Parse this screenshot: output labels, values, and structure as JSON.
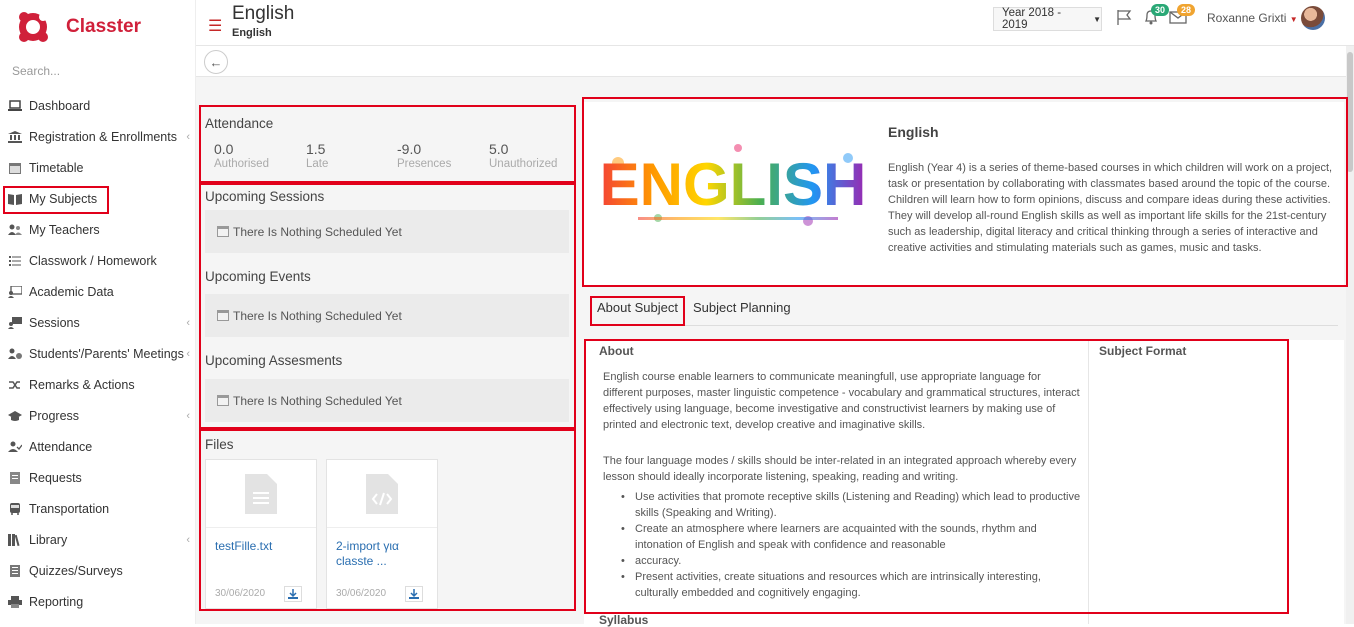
{
  "app": {
    "name": "Classter"
  },
  "search": {
    "placeholder": "Search..."
  },
  "sidebar": {
    "items": [
      {
        "label": "Dashboard",
        "icon": "laptop-icon"
      },
      {
        "label": "Registration & Enrollments",
        "icon": "bank-icon",
        "chevron": true
      },
      {
        "label": "Timetable",
        "icon": "calendar-icon"
      },
      {
        "label": "My Subjects",
        "icon": "book-icon"
      },
      {
        "label": "My Teachers",
        "icon": "users-icon"
      },
      {
        "label": "Classwork / Homework",
        "icon": "list-icon"
      },
      {
        "label": "Academic Data",
        "icon": "chalkboard-icon"
      },
      {
        "label": "Sessions",
        "icon": "sessions-icon",
        "chevron": true
      },
      {
        "label": "Students'/Parents' Meetings",
        "icon": "meeting-icon",
        "chevron": true
      },
      {
        "label": "Remarks & Actions",
        "icon": "shuffle-icon"
      },
      {
        "label": "Progress",
        "icon": "graduation-cap-icon",
        "chevron": true
      },
      {
        "label": "Attendance",
        "icon": "user-check-icon"
      },
      {
        "label": "Requests",
        "icon": "document-icon"
      },
      {
        "label": "Transportation",
        "icon": "bus-icon"
      },
      {
        "label": "Library",
        "icon": "library-icon",
        "chevron": true
      },
      {
        "label": "Quizzes/Surveys",
        "icon": "quiz-icon"
      },
      {
        "label": "Reporting",
        "icon": "printer-icon"
      }
    ]
  },
  "header": {
    "title": "English",
    "subtitle": "English",
    "year": "Year 2018 - 2019",
    "notifications": "30",
    "messages": "28",
    "user": "Roxanne Grixti"
  },
  "attendance": {
    "title": "Attendance",
    "items": [
      {
        "value": "0.0",
        "label": "Authorised"
      },
      {
        "value": "1.5",
        "label": "Late"
      },
      {
        "value": "-9.0",
        "label": "Presences"
      },
      {
        "value": "5.0",
        "label": "Unauthorized"
      }
    ]
  },
  "upcoming": {
    "sessions_title": "Upcoming Sessions",
    "events_title": "Upcoming Events",
    "assessments_title": "Upcoming Assesments",
    "empty_text": "There Is Nothing Scheduled Yet"
  },
  "files": {
    "title": "Files",
    "items": [
      {
        "name": "testFille.txt",
        "date": "30/06/2020",
        "icon": "text-file-icon"
      },
      {
        "name": "2-import για classte ...",
        "date": "30/06/2020",
        "icon": "code-file-icon"
      }
    ]
  },
  "subject": {
    "title": "English",
    "image_text": "ENGLISH",
    "description": "English (Year 4) is a series of theme-based courses in which children will work on a project, task or presentation by collaborating with classmates based around the topic of the course. Children will learn how to form opinions, discuss and compare ideas during these activities. They will develop all-round English skills as well as important life skills for the 21st-century such as leadership, digital literacy and critical thinking through a series of interactive and creative activities and stimulating materials such as games, music and tasks."
  },
  "tabs": {
    "about": "About Subject",
    "planning": "Subject Planning"
  },
  "about": {
    "heading": "About",
    "format_heading": "Subject Format",
    "para1": "English course enable learners to communicate meaningfull, use appropriate language for different purposes, master linguistic competence - vocabulary and grammatical structures, interact effectively using language, become investigative and constructivist learners by making use of printed and electronic text, develop creative and imaginative skills.",
    "para2": "The four language modes / skills should be inter-related in an integrated approach whereby every lesson should ideally incorporate listening, speaking, reading and writing.",
    "bullets": [
      "Use activities that promote receptive skills (Listening and Reading) which lead to productive skills (Speaking and Writing).",
      "Create an atmosphere where learners are acquainted with the sounds, rhythm and intonation of English and speak with confidence and reasonable",
      "accuracy.",
      "Present activities, create situations and resources which are intrinsically interesting, culturally embedded and cognitively engaging."
    ],
    "syllabus_heading": "Syllabus"
  }
}
